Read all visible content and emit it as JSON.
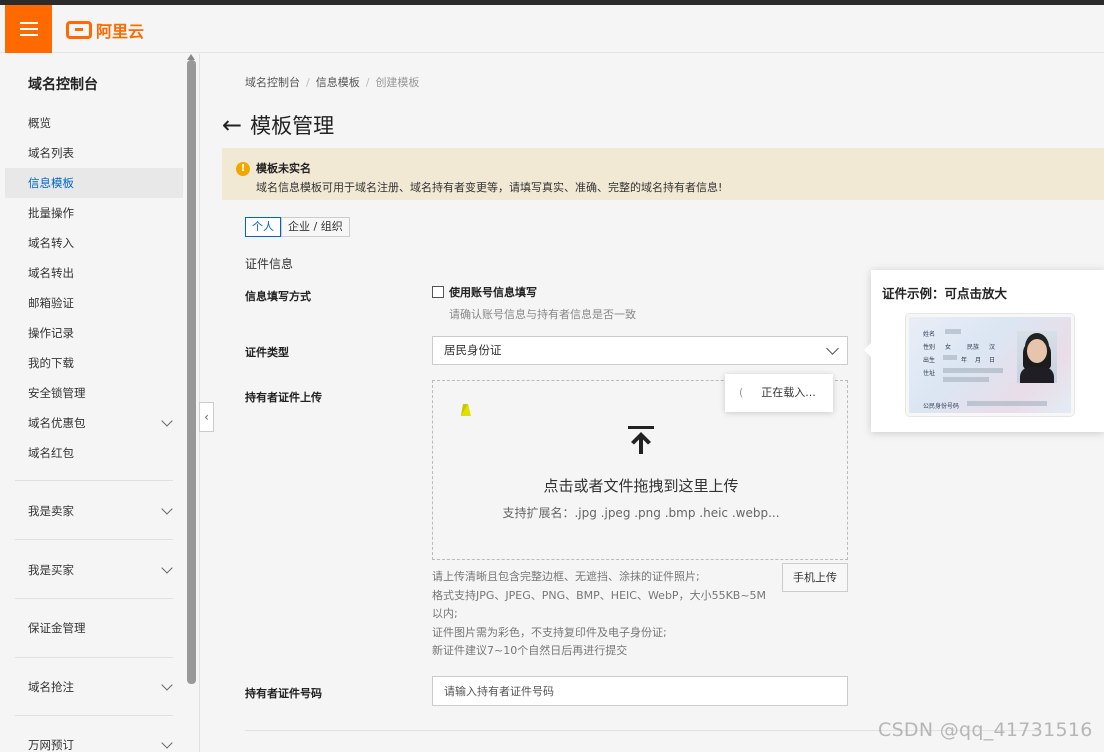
{
  "brand": {
    "logo_text": "阿里云",
    "accent": "#ff6a00"
  },
  "sidebar": {
    "title": "域名控制台",
    "items": [
      {
        "label": "概览"
      },
      {
        "label": "域名列表"
      },
      {
        "label": "信息模板",
        "active": true
      },
      {
        "label": "批量操作"
      },
      {
        "label": "域名转入"
      },
      {
        "label": "域名转出"
      },
      {
        "label": "邮箱验证"
      },
      {
        "label": "操作记录"
      },
      {
        "label": "我的下载"
      },
      {
        "label": "安全锁管理"
      },
      {
        "label": "域名优惠包",
        "expandable": true
      },
      {
        "label": "域名红包"
      }
    ],
    "groups": [
      {
        "label": "我是卖家",
        "expandable": true
      },
      {
        "label": "我是买家",
        "expandable": true
      },
      {
        "label": "保证金管理"
      },
      {
        "label": "域名抢注",
        "expandable": true
      },
      {
        "label": "万网预订",
        "expandable": true
      }
    ]
  },
  "breadcrumb": [
    "域名控制台",
    "信息模板",
    "创建模板"
  ],
  "page": {
    "title": "模板管理",
    "back_icon": "arrow-left-icon"
  },
  "notice": {
    "title": "模板未实名",
    "text": "域名信息模板可用于域名注册、域名持有者变更等，请填写真实、准确、完整的域名持有者信息!"
  },
  "tabs": [
    {
      "label": "个人",
      "active": true
    },
    {
      "label": "企业 / 组织"
    }
  ],
  "section": {
    "label": "证件信息"
  },
  "form": {
    "fill_method": {
      "label": "信息填写方式",
      "checkbox_label": "使用账号信息填写",
      "checked": false,
      "hint": "请确认账号信息与持有者信息是否一致"
    },
    "cert_type": {
      "label": "证件类型",
      "value": "居民身份证"
    },
    "upload": {
      "label": "持有者证件上传",
      "main_text": "点击或者文件拖拽到这里上传",
      "sub_text": "支持扩展名：.jpg .jpeg .png .bmp .heic .webp...",
      "loading_text": "正在载入...",
      "mobile_button": "手机上传",
      "requirements": [
        "请上传清晰且包含完整边框、无遮挡、涂抹的证件照片;",
        "格式支持JPG、JPEG、PNG、BMP、HEIC、WebP，大小55KB~5M以内;",
        "证件图片需为彩色，不支持复印件及电子身份证;",
        "新证件建议7~10个自然日后再进行提交"
      ]
    },
    "cert_number": {
      "label": "持有者证件号码",
      "placeholder": "请输入持有者证件号码"
    }
  },
  "example_popover": {
    "title": "证件示例：可点击放大",
    "card_fields": [
      "姓名",
      "性别",
      "民族",
      "出生",
      "年",
      "月",
      "日",
      "住址",
      "公民身份号码"
    ],
    "card_values": {
      "sex": "女",
      "ethnicity": "汉"
    }
  },
  "watermark": "CSDN @qq_41731516"
}
